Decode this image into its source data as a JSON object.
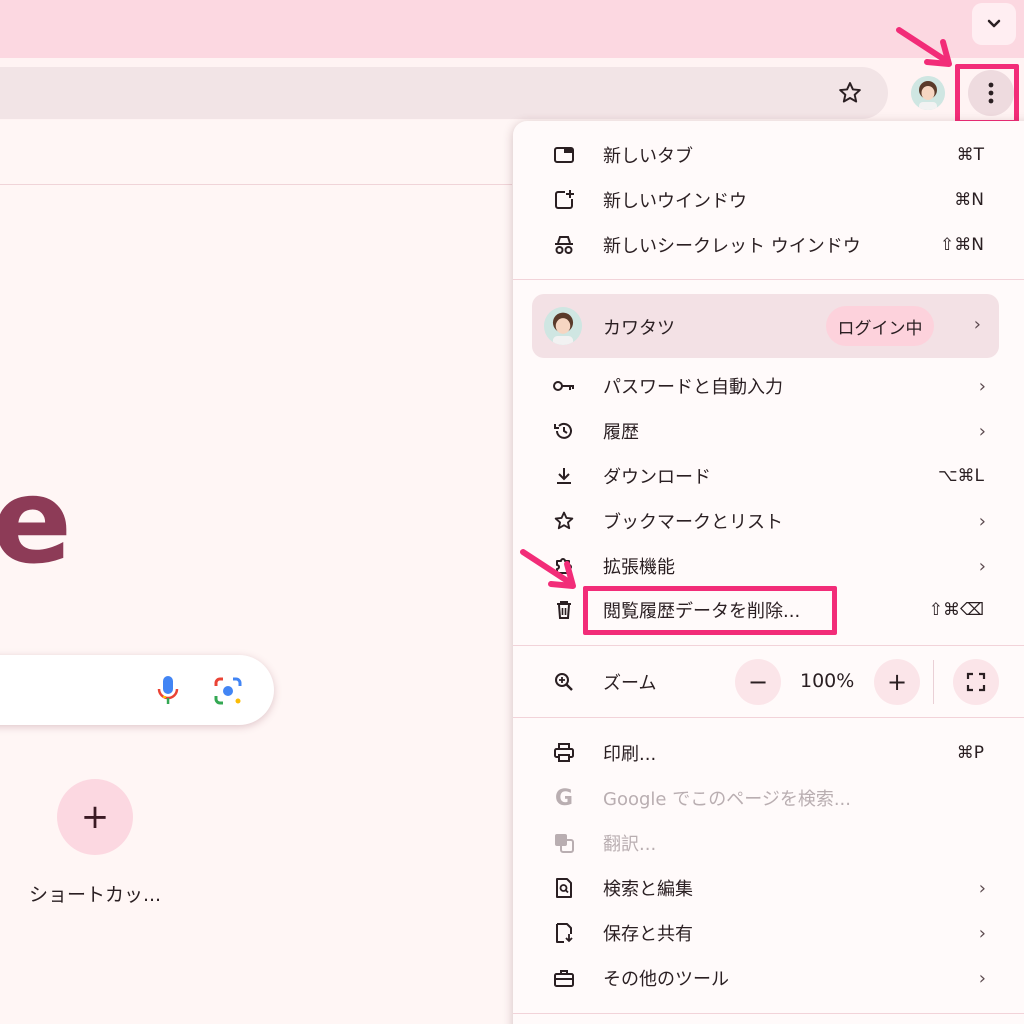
{
  "menu": {
    "new_tab": {
      "label": "新しいタブ",
      "shortcut": "⌘T"
    },
    "new_window": {
      "label": "新しいウインドウ",
      "shortcut": "⌘N"
    },
    "new_incognito": {
      "label": "新しいシークレット ウインドウ",
      "shortcut": "⇧⌘N"
    },
    "profile": {
      "name": "カワタツ",
      "status": "ログイン中"
    },
    "passwords": {
      "label": "パスワードと自動入力"
    },
    "history": {
      "label": "履歴"
    },
    "downloads": {
      "label": "ダウンロード",
      "shortcut": "⌥⌘L"
    },
    "bookmarks": {
      "label": "ブックマークとリスト"
    },
    "extensions": {
      "label": "拡張機能"
    },
    "clear_data": {
      "label": "閲覧履歴データを削除...",
      "shortcut": "⇧⌘⌫"
    },
    "zoom": {
      "label": "ズーム",
      "value": "100%",
      "minus": "−",
      "plus": "+"
    },
    "print": {
      "label": "印刷...",
      "shortcut": "⌘P"
    },
    "google_search": {
      "label": "Google でこのページを検索..."
    },
    "translate": {
      "label": "翻訳..."
    },
    "search_edit": {
      "label": "検索と編集"
    },
    "save_share": {
      "label": "保存と共有"
    },
    "more_tools": {
      "label": "その他のツール"
    }
  },
  "ntp": {
    "shortcut_label": "ショートカッ...",
    "add_symbol": "+",
    "logo_fragment": "e"
  },
  "colors": {
    "accent": "#f22c78",
    "tabstrip": "#fcd8e1",
    "logo": "#8d3b57"
  }
}
